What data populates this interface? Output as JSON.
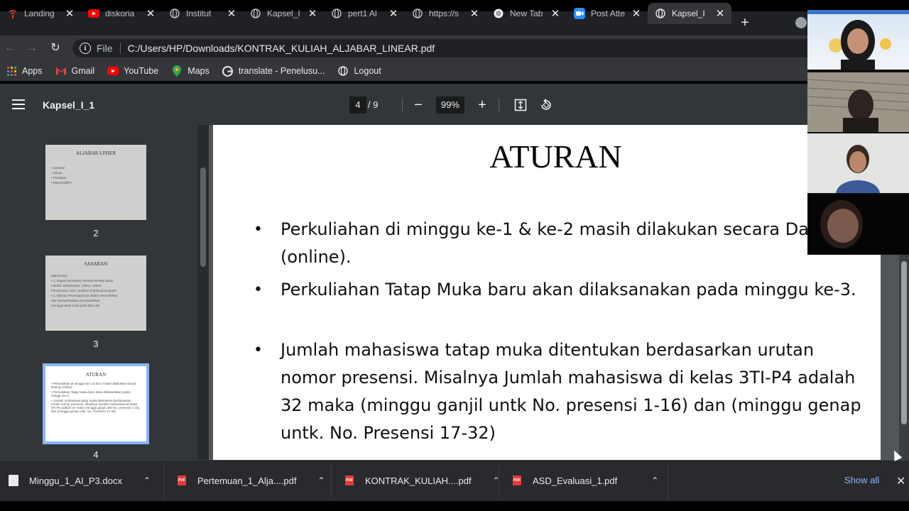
{
  "browser": {
    "tabs": [
      {
        "title": "Landing",
        "icon": "signal-icon"
      },
      {
        "title": "diskoria",
        "icon": "youtube-icon"
      },
      {
        "title": "Institut",
        "icon": "globe-icon"
      },
      {
        "title": "Kapsel_I",
        "icon": "globe-icon"
      },
      {
        "title": "pert1 Al",
        "icon": "globe-icon"
      },
      {
        "title": "https://s",
        "icon": "globe-icon"
      },
      {
        "title": "New Tab",
        "icon": "chrome-icon"
      },
      {
        "title": "Post Atte",
        "icon": "zoom-icon"
      },
      {
        "title": "Kapsel_I",
        "icon": "globe-icon",
        "active": true
      }
    ],
    "file_label": "File",
    "url": "C:/Users/HP/Downloads/KONTRAK_KULIAH_ALJABAR_LINEAR.pdf",
    "bookmarks": [
      {
        "label": "Apps",
        "icon": "apps-grid-icon"
      },
      {
        "label": "Gmail",
        "icon": "gmail-icon"
      },
      {
        "label": "YouTube",
        "icon": "youtube-icon"
      },
      {
        "label": "Maps",
        "icon": "maps-pin-icon"
      },
      {
        "label": "translate - Penelusu...",
        "icon": "google-icon"
      },
      {
        "label": "Logout",
        "icon": "globe-icon"
      }
    ]
  },
  "pdf": {
    "doc_title": "Kapsel_I_1",
    "current_page": "4",
    "total_pages": "/ 9",
    "zoom": "99%",
    "thumbnails": [
      {
        "num": "2",
        "heading": "ALJABAR LINIER",
        "lines": [
          "• Sasaran",
          "• Aturan",
          "• Penilaian",
          "• Materi/GBPP"
        ]
      },
      {
        "num": "3",
        "heading": "SASARAN",
        "lines": [
          "Mahasiswa:",
          "• 1. Dapat memahami konsep-konsep dasar",
          "matriks, Determinan, Vektor, Sistem",
          "Persamaan Linier, Aplikasi di bidang komputer",
          "• 2. Mampu Penerapannya dalam memodelkan",
          "dan menyelesaikan permasalahan",
          "menggunakan tools pada Mat Lab"
        ]
      },
      {
        "num": "4",
        "heading": "ATURAN",
        "lines": [
          "• Perkuliahan di minggu ke-1 & ke-2 masih dilakukan secara Daring (online).",
          "• Perkuliahan Tatap Muka baru akan dilaksanakan pada minggu ke-3.",
          "• Jumlah mahasiswa tatap muka ditentukan berdasarkan urutan nomor presensi. Misalnya Jumlah mahasiswa di kelas 3TI-P4 adalah 32 maka (minggu ganjil untk No. presensi 1-16) dan (minggu genap untk. No. Presensi 17-32)"
        ]
      }
    ],
    "page": {
      "title": "ATURAN",
      "bullets": [
        "Perkuliahan di minggu ke-1 & ke-2 masih dilakukan secara Daring (online).",
        "Perkuliahan Tatap Muka baru akan dilaksanakan pada minggu ke-3.",
        "Jumlah mahasiswa tatap muka ditentukan berdasarkan urutan nomor presensi. Misalnya Jumlah mahasiswa di kelas 3TI-P4 adalah 32 maka (minggu ganjil untk No. presensi 1-16) dan (minggu genap untk. No. Presensi 17-32)"
      ]
    }
  },
  "downloads": {
    "items": [
      {
        "name": "Minggu_1_AI_P3.docx",
        "type": "docx"
      },
      {
        "name": "Pertemuan_1_Alja....pdf",
        "type": "pdf"
      },
      {
        "name": "KONTRAK_KULIAH....pdf",
        "type": "pdf"
      },
      {
        "name": "ASD_Evaluasi_1.pdf",
        "type": "pdf"
      }
    ],
    "show_all": "Show all"
  },
  "colors": {
    "tabstrip": "#202124",
    "toolbar": "#35363a",
    "pdf_toolbar": "#323639",
    "accent": "#8ab4f8"
  }
}
